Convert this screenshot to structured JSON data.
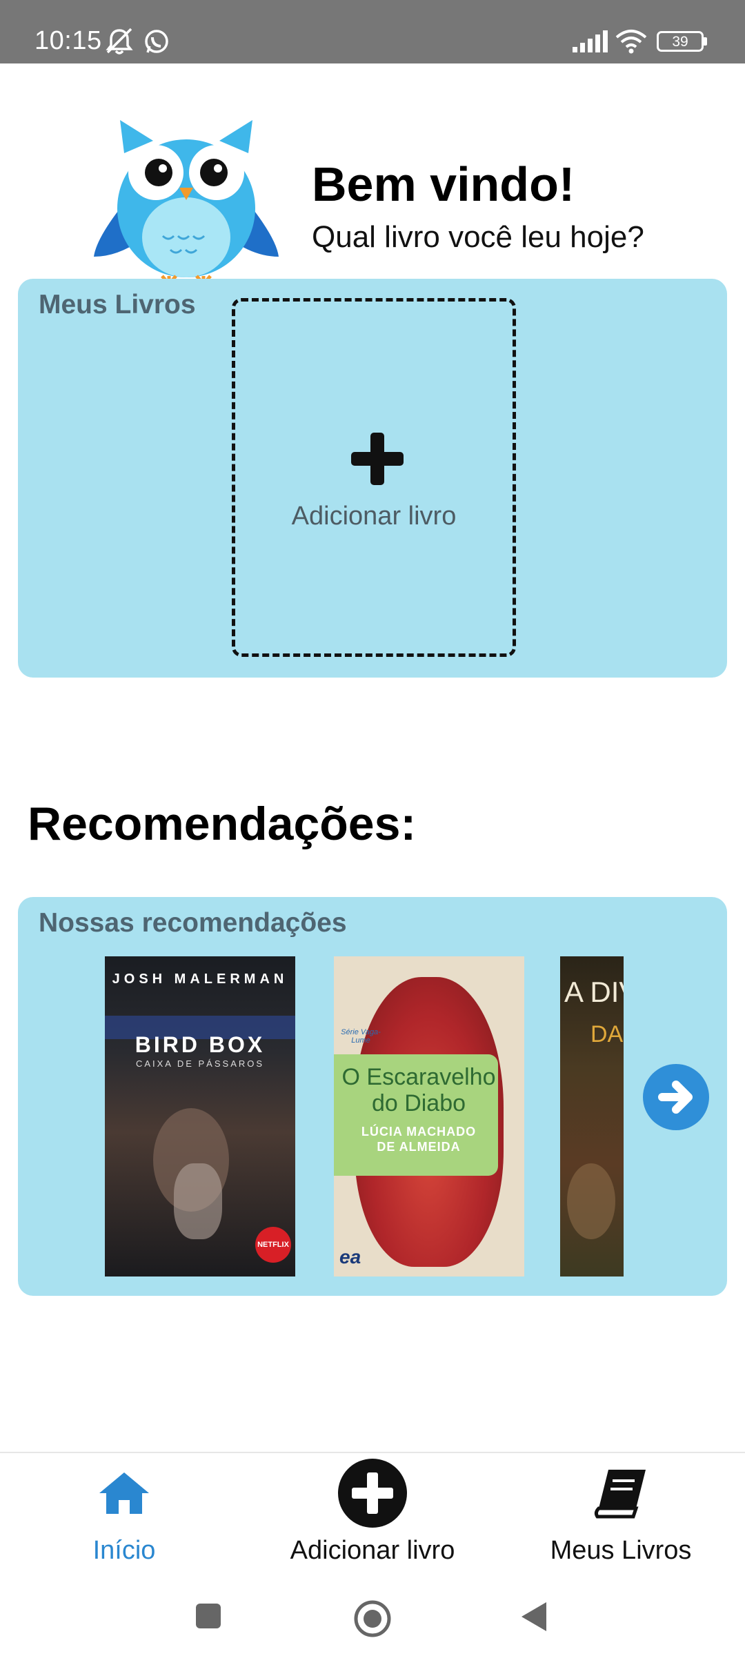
{
  "status_bar": {
    "time": "10:15",
    "battery": "39",
    "icons": [
      "mute-icon",
      "whatsapp-icon",
      "signal-icon",
      "wifi-icon",
      "battery-icon"
    ]
  },
  "header": {
    "title": "Bem vindo!",
    "subtitle": "Qual livro você leu hoje?",
    "mascot": "owl-icon"
  },
  "my_books": {
    "title": "Meus Livros",
    "add_label": "Adicionar livro",
    "add_icon": "plus-icon"
  },
  "recommendations": {
    "heading": "Recomendações:",
    "card_title": "Nossas recomendações",
    "books": [
      {
        "author": "JOSH MALERMAN",
        "title": "BIRD BOX",
        "subtitle": "CAIXA DE PÁSSAROS",
        "badge": "NETFLIX"
      },
      {
        "series": "Série Vaga-Lume",
        "title_line1": "O Escaravelho",
        "title_line2": "do Diabo",
        "author_line1": "LÚCIA MACHADO",
        "author_line2": "DE ALMEIDA",
        "publisher": "ea"
      },
      {
        "title": "A DIV",
        "author": "DAN"
      }
    ],
    "next_icon": "arrow-right-icon"
  },
  "bottom_nav": {
    "items": [
      {
        "label": "Início",
        "icon": "home-icon",
        "active": true
      },
      {
        "label": "Adicionar livro",
        "icon": "plus-circle-icon",
        "active": false
      },
      {
        "label": "Meus Livros",
        "icon": "book-icon",
        "active": false
      }
    ]
  },
  "colors": {
    "card_bg": "#a9e1f0",
    "active": "#2a87d0",
    "status_bar": "#777777"
  }
}
